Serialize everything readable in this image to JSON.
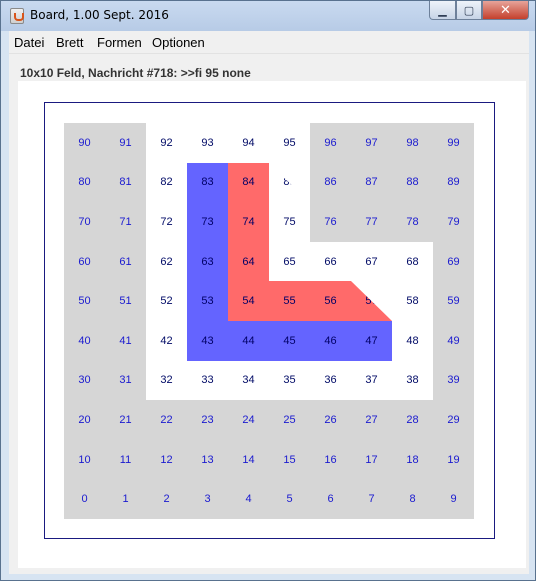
{
  "window": {
    "title": "Board, 1.00 Sept. 2016",
    "buttons": {
      "minimize": "▁",
      "maximize": "▢",
      "close": "✕"
    }
  },
  "menu": {
    "items": [
      "Datei",
      "Brett",
      "Formen",
      "Optionen"
    ]
  },
  "status": {
    "message": "10x10 Feld, Nachricht #718: >>fi 95 none"
  },
  "board": {
    "rows": 10,
    "cols": 10,
    "colors": {
      "gray": "#d6d6d6",
      "white": "#ffffff",
      "blue": "#6464ff",
      "red": "#ff6a6a",
      "number_gray": "#1a1ad0",
      "number_dark": "#000a66"
    },
    "cells": [
      {
        "n": "90",
        "c": "gray"
      },
      {
        "n": "91",
        "c": "gray"
      },
      {
        "n": "92",
        "c": "white"
      },
      {
        "n": "93",
        "c": "white"
      },
      {
        "n": "94",
        "c": "white"
      },
      {
        "n": "95",
        "c": "white"
      },
      {
        "n": "96",
        "c": "gray"
      },
      {
        "n": "97",
        "c": "gray"
      },
      {
        "n": "98",
        "c": "gray"
      },
      {
        "n": "99",
        "c": "gray"
      },
      {
        "n": "80",
        "c": "gray"
      },
      {
        "n": "81",
        "c": "gray"
      },
      {
        "n": "82",
        "c": "white"
      },
      {
        "n": "83",
        "c": "blue"
      },
      {
        "n": "84",
        "c": "red"
      },
      {
        "n": "85",
        "c": "white"
      },
      {
        "n": "86",
        "c": "gray"
      },
      {
        "n": "87",
        "c": "gray"
      },
      {
        "n": "88",
        "c": "gray"
      },
      {
        "n": "89",
        "c": "gray"
      },
      {
        "n": "70",
        "c": "gray"
      },
      {
        "n": "71",
        "c": "gray"
      },
      {
        "n": "72",
        "c": "white"
      },
      {
        "n": "73",
        "c": "blue"
      },
      {
        "n": "74",
        "c": "red"
      },
      {
        "n": "75",
        "c": "white"
      },
      {
        "n": "76",
        "c": "gray"
      },
      {
        "n": "77",
        "c": "gray"
      },
      {
        "n": "78",
        "c": "gray"
      },
      {
        "n": "79",
        "c": "gray"
      },
      {
        "n": "60",
        "c": "gray"
      },
      {
        "n": "61",
        "c": "gray"
      },
      {
        "n": "62",
        "c": "white"
      },
      {
        "n": "63",
        "c": "blue"
      },
      {
        "n": "64",
        "c": "red"
      },
      {
        "n": "65",
        "c": "white"
      },
      {
        "n": "66",
        "c": "white"
      },
      {
        "n": "67",
        "c": "white"
      },
      {
        "n": "68",
        "c": "white"
      },
      {
        "n": "69",
        "c": "gray"
      },
      {
        "n": "50",
        "c": "gray"
      },
      {
        "n": "51",
        "c": "gray"
      },
      {
        "n": "52",
        "c": "white"
      },
      {
        "n": "53",
        "c": "blue"
      },
      {
        "n": "54",
        "c": "red"
      },
      {
        "n": "55",
        "c": "red"
      },
      {
        "n": "56",
        "c": "red"
      },
      {
        "n": "57",
        "c": "red"
      },
      {
        "n": "58",
        "c": "white"
      },
      {
        "n": "59",
        "c": "gray"
      },
      {
        "n": "40",
        "c": "gray"
      },
      {
        "n": "41",
        "c": "gray"
      },
      {
        "n": "42",
        "c": "white"
      },
      {
        "n": "43",
        "c": "blue"
      },
      {
        "n": "44",
        "c": "blue"
      },
      {
        "n": "45",
        "c": "blue"
      },
      {
        "n": "46",
        "c": "blue"
      },
      {
        "n": "47",
        "c": "blue"
      },
      {
        "n": "48",
        "c": "white"
      },
      {
        "n": "49",
        "c": "gray"
      },
      {
        "n": "30",
        "c": "gray"
      },
      {
        "n": "31",
        "c": "gray"
      },
      {
        "n": "32",
        "c": "white"
      },
      {
        "n": "33",
        "c": "white"
      },
      {
        "n": "34",
        "c": "white"
      },
      {
        "n": "35",
        "c": "white"
      },
      {
        "n": "36",
        "c": "white"
      },
      {
        "n": "37",
        "c": "white"
      },
      {
        "n": "38",
        "c": "white"
      },
      {
        "n": "39",
        "c": "gray"
      },
      {
        "n": "20",
        "c": "gray"
      },
      {
        "n": "21",
        "c": "gray"
      },
      {
        "n": "22",
        "c": "gray"
      },
      {
        "n": "23",
        "c": "gray"
      },
      {
        "n": "24",
        "c": "gray"
      },
      {
        "n": "25",
        "c": "gray"
      },
      {
        "n": "26",
        "c": "gray"
      },
      {
        "n": "27",
        "c": "gray"
      },
      {
        "n": "28",
        "c": "gray"
      },
      {
        "n": "29",
        "c": "gray"
      },
      {
        "n": "10",
        "c": "gray"
      },
      {
        "n": "11",
        "c": "gray"
      },
      {
        "n": "12",
        "c": "gray"
      },
      {
        "n": "13",
        "c": "gray"
      },
      {
        "n": "14",
        "c": "gray"
      },
      {
        "n": "15",
        "c": "gray"
      },
      {
        "n": "16",
        "c": "gray"
      },
      {
        "n": "17",
        "c": "gray"
      },
      {
        "n": "18",
        "c": "gray"
      },
      {
        "n": "19",
        "c": "gray"
      },
      {
        "n": "0",
        "c": "gray"
      },
      {
        "n": "1",
        "c": "gray"
      },
      {
        "n": "2",
        "c": "gray"
      },
      {
        "n": "3",
        "c": "gray"
      },
      {
        "n": "4",
        "c": "gray"
      },
      {
        "n": "5",
        "c": "gray"
      },
      {
        "n": "6",
        "c": "gray"
      },
      {
        "n": "7",
        "c": "gray"
      },
      {
        "n": "8",
        "c": "gray"
      },
      {
        "n": "9",
        "c": "gray"
      }
    ]
  }
}
